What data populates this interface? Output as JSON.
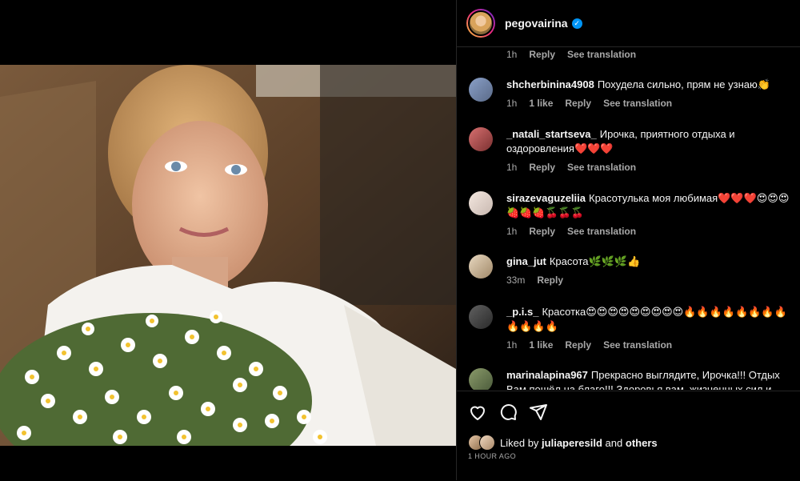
{
  "post": {
    "username": "pegovairina",
    "verified_icon": "verified-badge-icon"
  },
  "first_meta": {
    "time": "1h",
    "reply": "Reply",
    "translate": "See translation"
  },
  "comments": [
    {
      "user": "shcherbinina4908",
      "text": "Похудела сильно, прям не узнаю👏",
      "time": "1h",
      "likes": "1 like",
      "reply": "Reply",
      "translate": "See translation"
    },
    {
      "user": "_natali_startseva_",
      "text": "Ирочка, приятного отдыха и оздоровления❤️❤️❤️",
      "time": "1h",
      "likes": "",
      "reply": "Reply",
      "translate": "See translation"
    },
    {
      "user": "sirazevaguzeliia",
      "text": "Красотулька моя любимая❤️❤️❤️😍😍😍🍓🍓🍓🍒🍒🍒",
      "time": "1h",
      "likes": "",
      "reply": "Reply",
      "translate": "See translation"
    },
    {
      "user": "gina_jut",
      "text": "Красота🌿🌿🌿👍",
      "time": "33m",
      "likes": "",
      "reply": "Reply",
      "translate": ""
    },
    {
      "user": "_p.i.s_",
      "text": "Красотка😍😍😍😍😍😍😍😍😍🔥🔥🔥🔥🔥🔥🔥🔥🔥🔥🔥🔥",
      "time": "1h",
      "likes": "1 like",
      "reply": "Reply",
      "translate": "See translation"
    },
    {
      "user": "marinalapina967",
      "text": "Прекрасно выглядите, Ирочка!!! Отдых Вам пошёл на благо!!! Здоровья вам, жизненных сил и",
      "time": "",
      "likes": "",
      "reply": "",
      "translate": ""
    }
  ],
  "actions": {
    "like_icon": "heart-icon",
    "comment_icon": "comment-icon",
    "share_icon": "share-icon"
  },
  "likes": {
    "prefix": "Liked by",
    "user": "juliaperesild",
    "and": "and",
    "others": "others"
  },
  "timestamp": "1 HOUR AGO",
  "colors": {
    "background": "#000000",
    "text": "#f5f5f5",
    "muted": "#a8a8a8",
    "verified": "#0095f6",
    "divider": "#262626"
  }
}
